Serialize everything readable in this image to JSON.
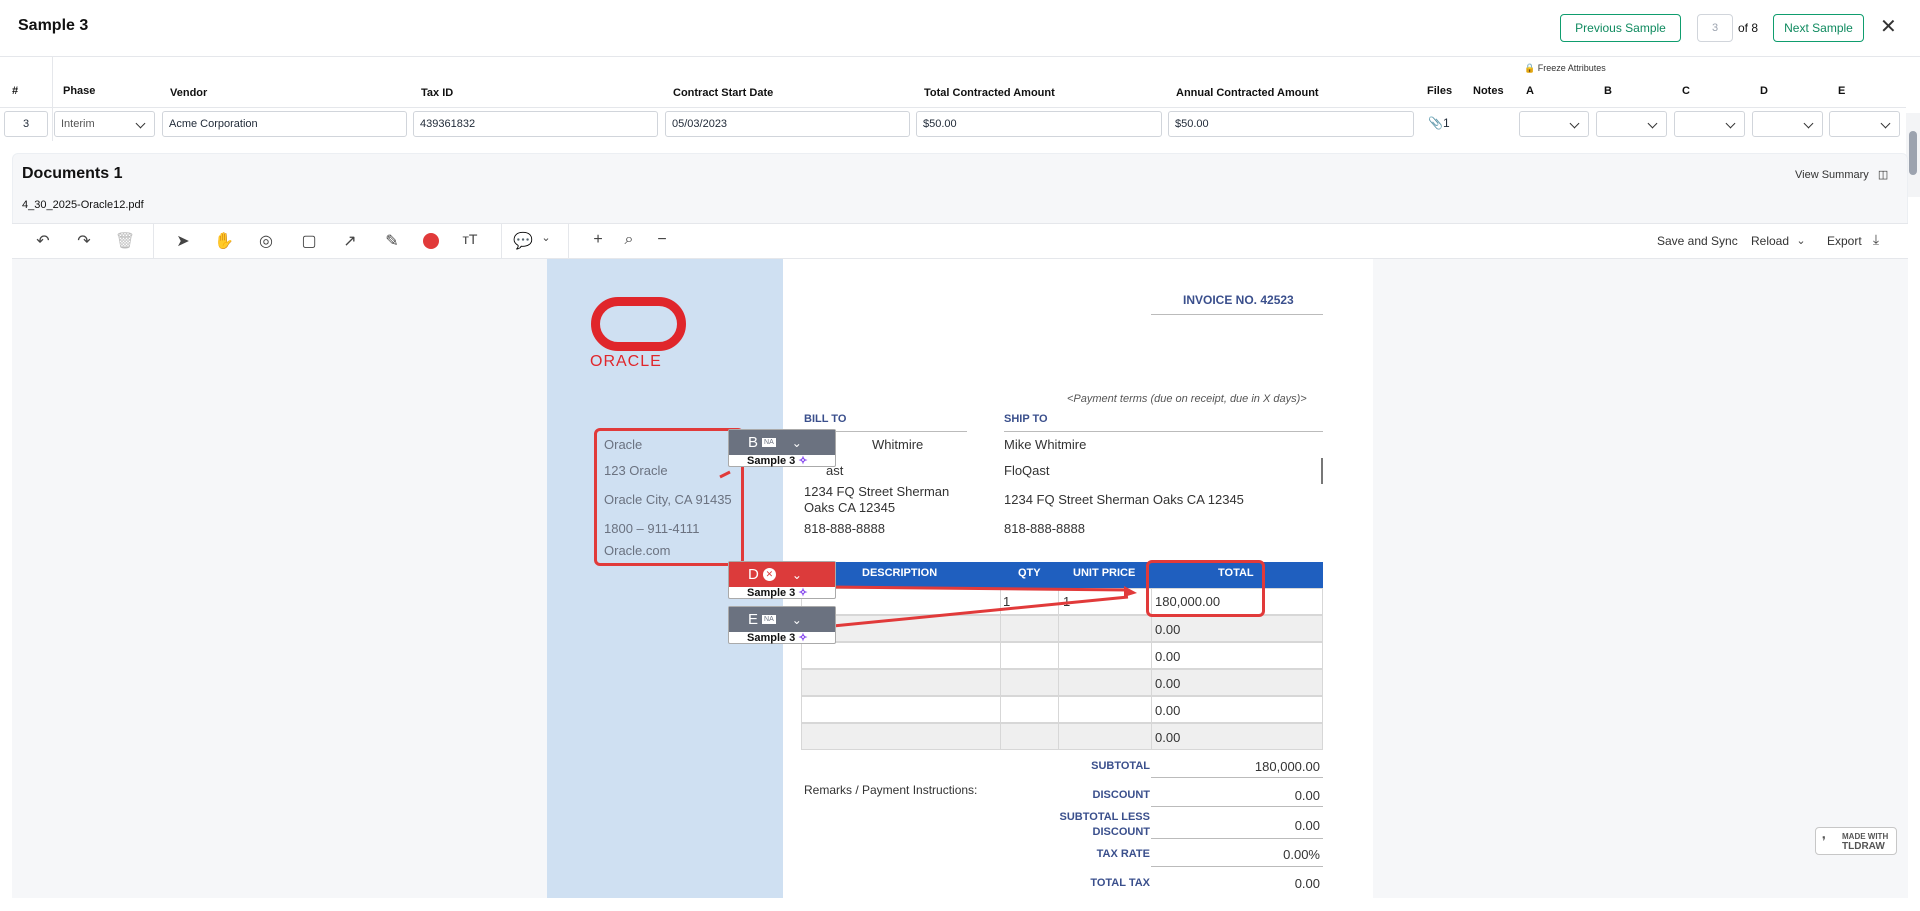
{
  "header": {
    "title": "Sample 3",
    "prev_label": "Previous Sample",
    "page_value": "3",
    "page_of": "of 8",
    "next_label": "Next Sample",
    "close": "✕"
  },
  "grid": {
    "freeze_label": "Freeze Attributes",
    "columns": [
      "#",
      "Phase",
      "Vendor",
      "Tax ID",
      "Contract Start Date",
      "Total Contracted Amount",
      "Annual Contracted Amount",
      "Files",
      "Notes",
      "A",
      "B",
      "C",
      "D",
      "E"
    ],
    "row": {
      "num": "3",
      "phase": "Interim",
      "vendor": "Acme Corporation",
      "tax_id": "439361832",
      "start_date": "05/03/2023",
      "total_amount": "$50.00",
      "annual_amount": "$50.00",
      "files_count": "1"
    }
  },
  "documents": {
    "title": "Documents 1",
    "file_name": "4_30_2025-Oracle12.pdf",
    "view_summary": "View Summary"
  },
  "toolbar": {
    "save_sync": "Save and Sync",
    "reload": "Reload",
    "export": "Export"
  },
  "invoice": {
    "logo_text": "ORACLE",
    "invoice_no": "INVOICE NO. 42523",
    "payment_terms": "<Payment terms (due on receipt, due in X days)>",
    "bill_to": "BILL TO",
    "ship_to": "SHIP TO",
    "bill_lines": [
      "Whitmire",
      "ast",
      "1234 FQ Street Sherman",
      "Oaks CA 12345",
      "818-888-8888"
    ],
    "ship_lines": [
      "Mike Whitmire",
      "FloQast",
      "1234 FQ Street Sherman Oaks CA 12345",
      "818-888-8888"
    ],
    "from_lines": [
      "Oracle",
      "123 Oracle",
      "Oracle City, CA 91435",
      "1800 – 911-4111",
      "Oracle.com"
    ],
    "table_headers": [
      "DESCRIPTION",
      "QTY",
      "UNIT PRICE",
      "TOTAL"
    ],
    "row1": {
      "qty": "1",
      "unit": "1",
      "total": "180,000.00"
    },
    "totals": [
      "0.00",
      "0.00",
      "0.00",
      "0.00",
      "0.00"
    ],
    "remarks": "Remarks / Payment Instructions:",
    "summary": [
      {
        "label": "SUBTOTAL",
        "value": "180,000.00"
      },
      {
        "label": "DISCOUNT",
        "value": "0.00"
      },
      {
        "label": "SUBTOTAL LESS",
        "label2": "DISCOUNT",
        "value": "0.00"
      },
      {
        "label": "TAX RATE",
        "value": "0.00%"
      },
      {
        "label": "TOTAL TAX",
        "value": "0.00"
      }
    ]
  },
  "tags": {
    "b": {
      "letter": "B",
      "na": "NA",
      "sample": "Sample 3"
    },
    "d": {
      "letter": "D",
      "sample": "Sample 3"
    },
    "e": {
      "letter": "E",
      "na": "NA",
      "sample": "Sample 3"
    }
  },
  "tldraw": {
    "line1": "MADE WITH",
    "line2": "TLDRAW"
  },
  "colors": {
    "accent": "#0f9d6e",
    "annotation_red": "#e13a3a",
    "tag_gray": "#6b7280",
    "invoice_blue": "#1f5fbf",
    "oracle_red": "#e0262b"
  }
}
